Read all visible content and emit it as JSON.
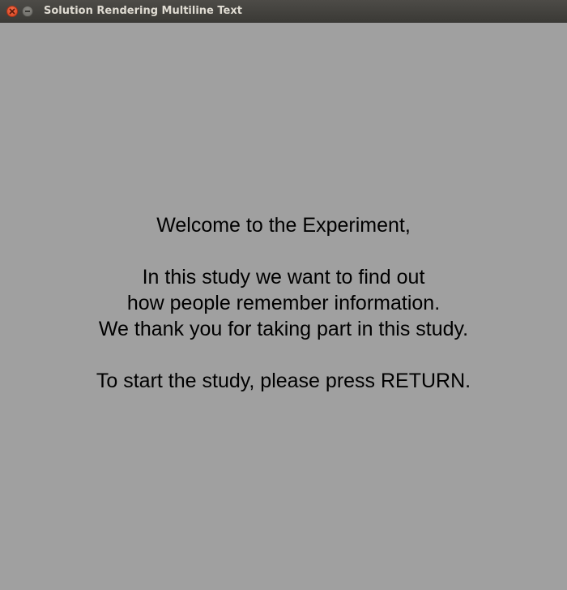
{
  "window": {
    "title": "Solution Rendering Multiline Text",
    "close_icon": "close-icon",
    "minimize_icon": "minimize-icon"
  },
  "colors": {
    "background": "#a0a0a0",
    "text": "#000000",
    "titlebar": "#3f3e3a",
    "close_button": "#e8572f"
  },
  "message": {
    "line1": "Welcome to the Experiment,",
    "line2": "In this study we want to find out",
    "line3": "how people remember information.",
    "line4": "We thank you for taking part in this study.",
    "line5": "To start the study, please press RETURN."
  }
}
